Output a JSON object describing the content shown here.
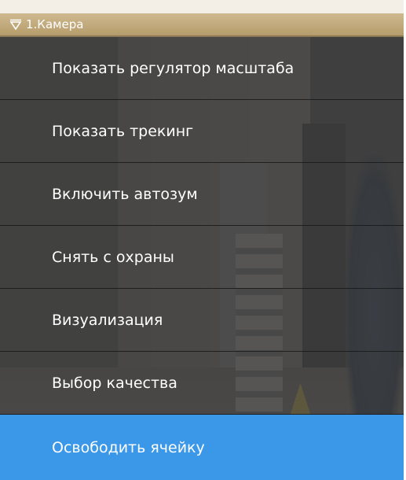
{
  "window": {
    "title": "1.Камера",
    "title_icon": "filter-triangle-icon"
  },
  "menu": {
    "items": [
      {
        "label": "Показать регулятор масштаба",
        "active": false
      },
      {
        "label": "Показать трекинг",
        "active": false
      },
      {
        "label": "Включить автозум",
        "active": false
      },
      {
        "label": "Снять с охраны",
        "active": false
      },
      {
        "label": "Визуализация",
        "active": false
      },
      {
        "label": "Выбор качества",
        "active": false
      },
      {
        "label": "Освободить ячейку",
        "active": true
      }
    ]
  },
  "colors": {
    "title_bar": "#b59c6c",
    "menu_item_bg": "#3a3a3c",
    "active_item": "#3b97e8"
  }
}
